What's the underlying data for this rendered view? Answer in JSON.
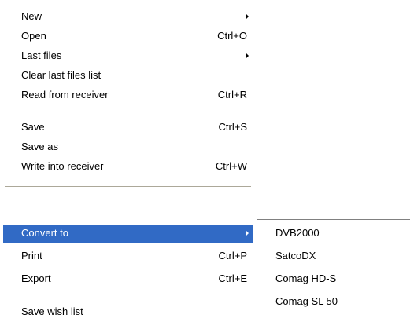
{
  "menu": {
    "items": [
      {
        "label": "New",
        "shortcut": "",
        "has_submenu": true
      },
      {
        "label": "Open",
        "shortcut": "Ctrl+O",
        "has_submenu": false
      },
      {
        "label": "Last files",
        "shortcut": "",
        "has_submenu": true
      },
      {
        "label": "Clear last files list",
        "shortcut": "",
        "has_submenu": false
      },
      {
        "label": "Read from receiver",
        "shortcut": "Ctrl+R",
        "has_submenu": false
      },
      {
        "label": "Save",
        "shortcut": "Ctrl+S",
        "has_submenu": false
      },
      {
        "label": "Save as",
        "shortcut": "",
        "has_submenu": false
      },
      {
        "label": "Write into receiver",
        "shortcut": "Ctrl+W",
        "has_submenu": false
      },
      {
        "label": "Convert to",
        "shortcut": "",
        "has_submenu": true,
        "highlighted": true
      },
      {
        "label": "Print",
        "shortcut": "Ctrl+P",
        "has_submenu": false
      },
      {
        "label": "Export",
        "shortcut": "Ctrl+E",
        "has_submenu": false
      },
      {
        "label": "Save wish list",
        "shortcut": "",
        "has_submenu": false
      }
    ]
  },
  "submenu": {
    "items": [
      {
        "label": "DVB2000"
      },
      {
        "label": "SatcoDX"
      },
      {
        "label": "Comag HD-S"
      },
      {
        "label": "Comag SL 50"
      }
    ]
  },
  "colors": {
    "highlight_bg": "#316ac5",
    "highlight_text": "#ffffff",
    "separator": "#aca899"
  }
}
